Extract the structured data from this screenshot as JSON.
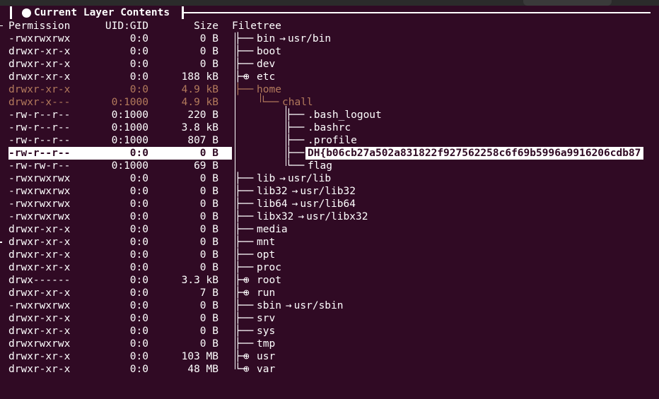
{
  "titlebar": {
    "title": "Current Layer Contents"
  },
  "header": {
    "permission": "Permission",
    "uidgid": "UID:GID",
    "size": "Size",
    "filetree": "Filetree"
  },
  "rows": [
    {
      "perm": "-rwxrwxrwx",
      "uid": "0:0",
      "size": "0 B",
      "name": "bin",
      "link": "usr/bin"
    },
    {
      "perm": "drwxr-xr-x",
      "uid": "0:0",
      "size": "0 B",
      "name": "boot"
    },
    {
      "perm": "drwxr-xr-x",
      "uid": "0:0",
      "size": "0 B",
      "name": "dev"
    },
    {
      "perm": "drwxr-xr-x",
      "uid": "0:0",
      "size": "188 kB",
      "name": "etc",
      "collapsed": true
    },
    {
      "perm": "drwxr-xr-x",
      "uid": "0:0",
      "size": "4.9 kB",
      "name": "home",
      "dim": true
    },
    {
      "perm": "drwxr-x---",
      "uid": "0:1000",
      "size": "4.9 kB",
      "name": "chall",
      "dim": true
    },
    {
      "perm": "-rw-r--r--",
      "uid": "0:1000",
      "size": "220 B",
      "name": ".bash_logout"
    },
    {
      "perm": "-rw-r--r--",
      "uid": "0:1000",
      "size": "3.8 kB",
      "name": ".bashrc"
    },
    {
      "perm": "-rw-r--r--",
      "uid": "0:1000",
      "size": "807 B",
      "name": ".profile"
    },
    {
      "perm": "-rw-r--r--",
      "uid": "0:0",
      "size": "0 B",
      "name": "DH{b06cb27a502a831822f927562258c6f69b5996a9916206cdb87",
      "selected": true
    },
    {
      "perm": "-rw-rw-r--",
      "uid": "0:1000",
      "size": "69 B",
      "name": "flag"
    },
    {
      "perm": "-rwxrwxrwx",
      "uid": "0:0",
      "size": "0 B",
      "name": "lib",
      "link": "usr/lib"
    },
    {
      "perm": "-rwxrwxrwx",
      "uid": "0:0",
      "size": "0 B",
      "name": "lib32",
      "link": "usr/lib32"
    },
    {
      "perm": "-rwxrwxrwx",
      "uid": "0:0",
      "size": "0 B",
      "name": "lib64",
      "link": "usr/lib64"
    },
    {
      "perm": "-rwxrwxrwx",
      "uid": "0:0",
      "size": "0 B",
      "name": "libx32",
      "link": "usr/libx32"
    },
    {
      "perm": "drwxr-xr-x",
      "uid": "0:0",
      "size": "0 B",
      "name": "media"
    },
    {
      "perm": "drwxr-xr-x",
      "uid": "0:0",
      "size": "0 B",
      "name": "mnt"
    },
    {
      "perm": "drwxr-xr-x",
      "uid": "0:0",
      "size": "0 B",
      "name": "opt"
    },
    {
      "perm": "drwxr-xr-x",
      "uid": "0:0",
      "size": "0 B",
      "name": "proc"
    },
    {
      "perm": "drwx------",
      "uid": "0:0",
      "size": "3.3 kB",
      "name": "root",
      "collapsed": true
    },
    {
      "perm": "drwxr-xr-x",
      "uid": "0:0",
      "size": "7 B",
      "name": "run",
      "collapsed": true
    },
    {
      "perm": "-rwxrwxrwx",
      "uid": "0:0",
      "size": "0 B",
      "name": "sbin",
      "link": "usr/sbin"
    },
    {
      "perm": "drwxr-xr-x",
      "uid": "0:0",
      "size": "0 B",
      "name": "srv"
    },
    {
      "perm": "drwxr-xr-x",
      "uid": "0:0",
      "size": "0 B",
      "name": "sys"
    },
    {
      "perm": "drwxrwxrwx",
      "uid": "0:0",
      "size": "0 B",
      "name": "tmp"
    },
    {
      "perm": "drwxr-xr-x",
      "uid": "0:0",
      "size": "103 MB",
      "name": "usr",
      "collapsed": true
    },
    {
      "perm": "drwxr-xr-x",
      "uid": "0:0",
      "size": "48 MB",
      "name": "var",
      "collapsed": true
    }
  ],
  "colors": {
    "background": "#300a24",
    "text": "#ffffff",
    "dim": "#b37a5c"
  },
  "icons": {
    "collapsed": "circled-plus-icon",
    "link": "right-arrow-icon",
    "title": "filled-circle-icon"
  }
}
